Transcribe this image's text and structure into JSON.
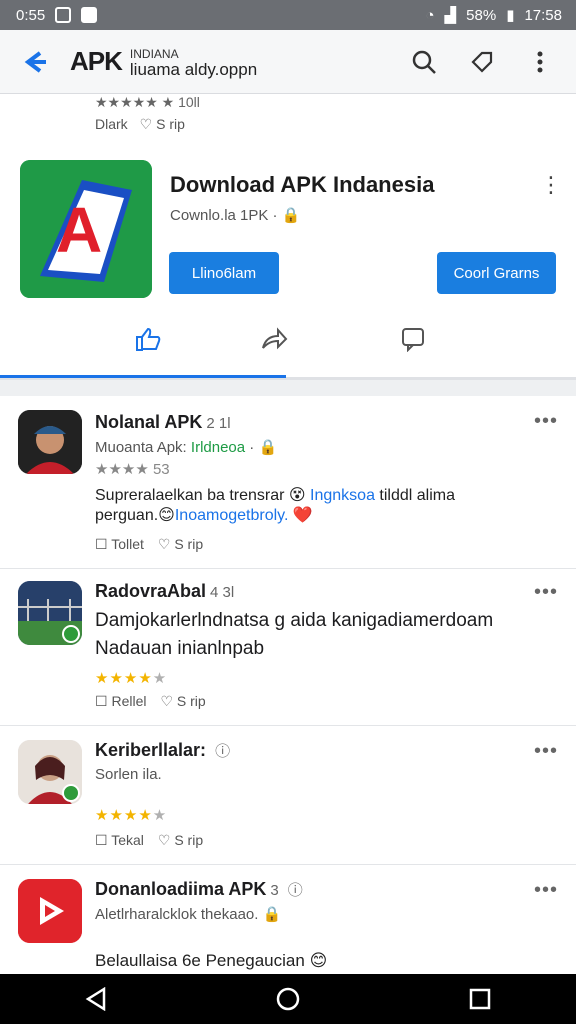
{
  "status": {
    "time_left": "0:55",
    "battery": "58%",
    "time_right": "17:58"
  },
  "appbar": {
    "brand": "APK",
    "line1": "INDIANA",
    "line2": "liuama aldy.oppn"
  },
  "card1": {
    "top_rating": "★★★★★ ★ 10ll",
    "top_actions": {
      "a": "Dlark",
      "b": "S rip"
    },
    "title": "Download APK Indanesia",
    "subtitle": "Cownlo.la 1PK",
    "btn_left": "Llino6lam",
    "btn_right": "Coorl Grarns"
  },
  "posts": [
    {
      "name": "Nolanal APK",
      "time": "2 1l",
      "handle": "Muoanta Apk:",
      "handle_hl": "Irldneoa",
      "rating": "★★★★ 53",
      "body1": "Supreralaelkan ba trensrar",
      "link1": "Ingnksoa",
      "body2": "tilddl alima",
      "body3": "perguan.",
      "link2": "Inoamogetbroly.",
      "a": "Tollet",
      "b": "S rip"
    },
    {
      "name": "RadovraAbal",
      "time": "4 3l",
      "body1": "Damjokarlerlndnatsa g aida kanigadiamerdoam",
      "body2": "Nadauan inianlnpab",
      "a": "Rellel",
      "b": "S rip"
    },
    {
      "name": "Keriberllalar:",
      "time": "",
      "handle": "Sorlen ila.",
      "a": "Tekal",
      "b": "S rip"
    },
    {
      "name": "Donanloadiima APK",
      "time": "3",
      "handle": "Aletlrharalcklok thekaao.",
      "body1": "Belaullaisa 6e Penegaucian"
    }
  ],
  "colors": {
    "accent": "#1a73e8",
    "button": "#1a7ee0",
    "star": "#f3b400",
    "green": "#1e9b45"
  }
}
